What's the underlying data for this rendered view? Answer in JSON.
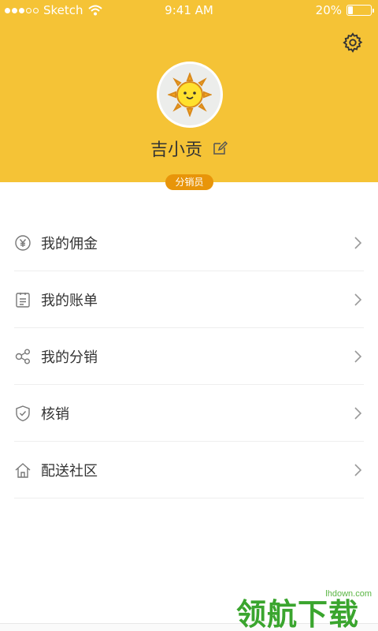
{
  "status_bar": {
    "carrier": "Sketch",
    "time": "9:41 AM",
    "battery_text": "20%",
    "battery_level": 0.2
  },
  "header": {
    "bg_color": "#F5C336",
    "settings_icon": "gear-icon",
    "avatar_icon": "sun-face-avatar",
    "user_name": "吉小贡",
    "edit_icon": "edit-icon"
  },
  "badge": {
    "label": "分销员",
    "color": "#E8950A"
  },
  "menu": {
    "items": [
      {
        "label": "我的佣金",
        "icon": "yuan-coin-icon"
      },
      {
        "label": "我的账单",
        "icon": "clipboard-icon"
      },
      {
        "label": "我的分销",
        "icon": "share-nodes-icon"
      },
      {
        "label": "核销",
        "icon": "shield-check-icon"
      },
      {
        "label": "配送社区",
        "icon": "home-icon"
      }
    ]
  },
  "watermark": {
    "site": "lhdown.com",
    "text": "领航下载"
  }
}
